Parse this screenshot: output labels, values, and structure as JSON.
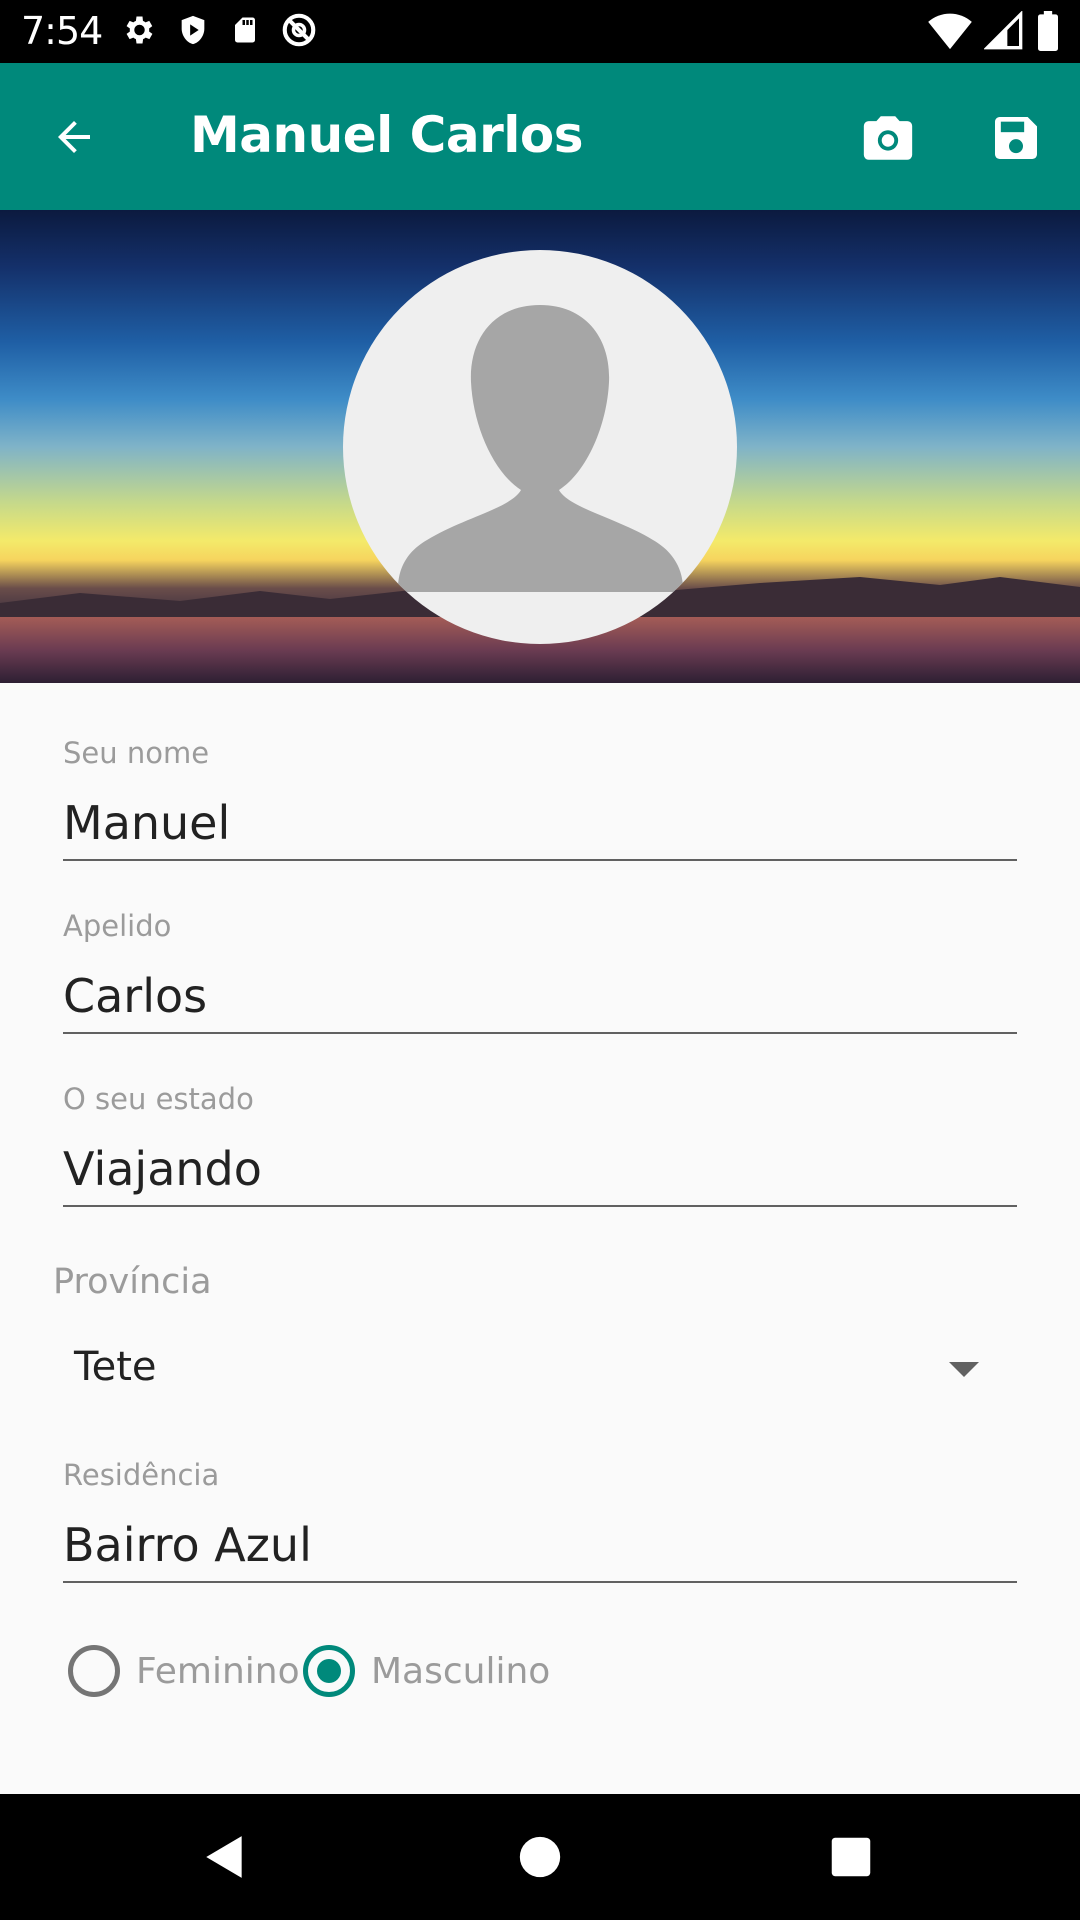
{
  "status_bar": {
    "time": "7:54",
    "left_icons": [
      "settings-icon",
      "shield-play-icon",
      "sd-card-icon",
      "no-disturb-icon"
    ],
    "right_icons": [
      "wifi-icon",
      "cell-signal-icon",
      "battery-icon"
    ]
  },
  "app_bar": {
    "title": "Manuel Carlos",
    "back_icon": "arrow-back-icon",
    "actions": [
      "camera-icon",
      "save-icon"
    ]
  },
  "header": {
    "avatar_icon": "person-placeholder-icon"
  },
  "form": {
    "first_name": {
      "label": "Seu nome",
      "value": "Manuel"
    },
    "last_name": {
      "label": "Apelido",
      "value": "Carlos"
    },
    "status": {
      "label": "O seu estado",
      "value": "Viajando"
    },
    "province": {
      "label": "Província",
      "value": "Tete"
    },
    "residence": {
      "label": "Residência",
      "value": "Bairro Azul"
    },
    "gender": {
      "options": [
        {
          "label": "Feminino",
          "checked": false
        },
        {
          "label": "Masculino",
          "checked": true
        }
      ]
    }
  },
  "nav_bar": {
    "buttons": [
      "back-triangle-icon",
      "home-circle-icon",
      "recents-square-icon"
    ]
  },
  "colors": {
    "primary": "#00897b",
    "accent": "#00897b"
  }
}
